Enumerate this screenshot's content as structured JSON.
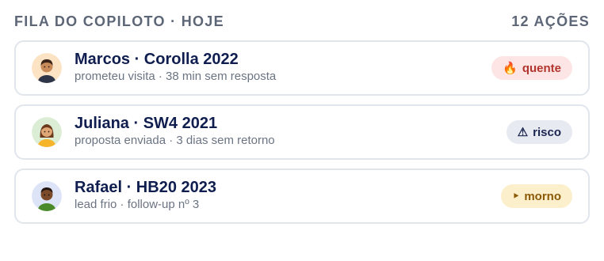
{
  "header": {
    "title": "FILA DO COPILOTO · HOJE",
    "count": "12 AÇÕES"
  },
  "cards": [
    {
      "title": "Marcos · Corolla 2022",
      "subtitle": "prometeu visita · 38 min sem resposta",
      "badge": {
        "icon": "🔥",
        "icon_name": "fire-icon",
        "label": "quente",
        "color": "#b3342c",
        "bg": "#fde5e5"
      },
      "avatar": {
        "bg": "#fbe3c4",
        "skin": "#c98a5a",
        "hair": "#3a2418",
        "shirt": "#2e3548"
      }
    },
    {
      "title": "Juliana · SW4 2021",
      "subtitle": "proposta enviada · 3 dias sem retorno",
      "badge": {
        "icon": "⚠",
        "icon_name": "warning-icon",
        "label": "risco",
        "color": "#1b2650",
        "bg": "#e8eaf1"
      },
      "avatar": {
        "bg": "#dcedd5",
        "skin": "#e0a776",
        "hair": "#6b3a1c",
        "shirt": "#f5b42a"
      }
    },
    {
      "title": "Rafael · HB20 2023",
      "subtitle": "lead frio · follow-up nº 3",
      "badge": {
        "icon": "‣",
        "icon_name": "arrow-icon",
        "label": "morno",
        "color": "#8b5a06",
        "bg": "#fcefcb"
      },
      "avatar": {
        "bg": "#dde4f7",
        "skin": "#7a4a2a",
        "hair": "#221510",
        "shirt": "#4a8a2a"
      }
    }
  ]
}
